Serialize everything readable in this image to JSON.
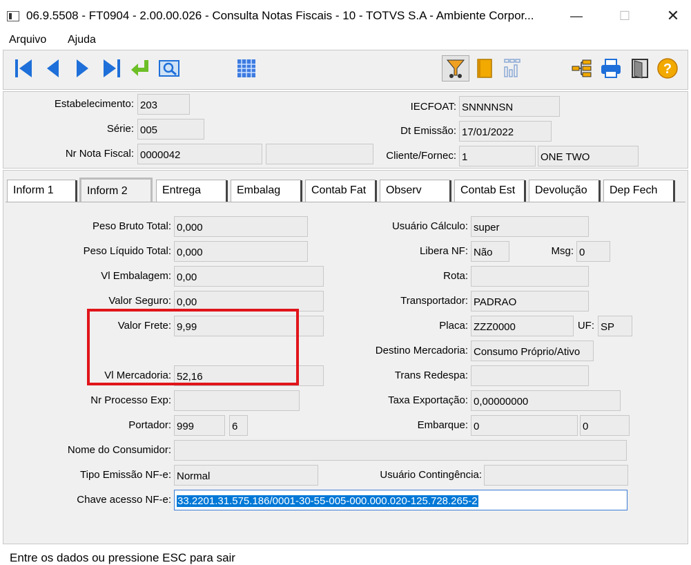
{
  "window": {
    "title": "06.9.5508 - FT0904 - 2.00.00.026 - Consulta Notas Fiscais - 10 - TOTVS S.A - Ambiente Corpor...",
    "minimize": "—",
    "maximize": "☐",
    "close": "✕"
  },
  "menu": {
    "file": "Arquivo",
    "help": "Ajuda"
  },
  "header": {
    "estabelecimento_label": "Estabelecimento:",
    "estabelecimento": "203",
    "serie_label": "Série:",
    "serie": "005",
    "nr_nota_label": "Nr Nota Fiscal:",
    "nr_nota": "0000042",
    "nr_nota_extra": "",
    "iecfoat_label": "IECFOAT:",
    "iecfoat": "SNNNNSN",
    "dt_emissao_label": "Dt Emissão:",
    "dt_emissao": "17/01/2022",
    "cliente_label": "Cliente/Fornec:",
    "cliente_code": "1",
    "cliente_name": "ONE TWO"
  },
  "tabs": [
    {
      "label": "Inform 1"
    },
    {
      "label": "Inform 2"
    },
    {
      "label": "Entrega"
    },
    {
      "label": "Embalag"
    },
    {
      "label": "Contab Fat"
    },
    {
      "label": "Observ"
    },
    {
      "label": "Contab Est"
    },
    {
      "label": "Devolução"
    },
    {
      "label": "Dep Fech"
    }
  ],
  "form": {
    "peso_bruto_label": "Peso Bruto Total:",
    "peso_bruto": "0,000",
    "peso_liquido_label": "Peso Líquido Total:",
    "peso_liquido": "0,000",
    "vl_embalagem_label": "Vl Embalagem:",
    "vl_embalagem": "0,00",
    "valor_seguro_label": "Valor Seguro:",
    "valor_seguro": "0,00",
    "valor_frete_label": "Valor Frete:",
    "valor_frete": "9,99",
    "vl_mercadoria_label": "Vl Mercadoria:",
    "vl_mercadoria": "52,16",
    "nr_processo_label": "Nr Processo Exp:",
    "nr_processo": "",
    "portador_label": "Portador:",
    "portador": "999",
    "portador_mod": "6",
    "nome_consumidor_label": "Nome do Consumidor:",
    "nome_consumidor": "",
    "tipo_emissao_label": "Tipo Emissão NF-e:",
    "tipo_emissao": "Normal",
    "chave_label": "Chave acesso NF-e:",
    "chave": "33.2201.31.575.186/0001-30-55-005-000.000.020-125.728.265-2",
    "usuario_calculo_label": "Usuário Cálculo:",
    "usuario_calculo": "super",
    "libera_nf_label": "Libera NF:",
    "libera_nf": "Não",
    "msg_label": "Msg:",
    "msg": "0",
    "rota_label": "Rota:",
    "rota": "",
    "transportador_label": "Transportador:",
    "transportador": "PADRAO",
    "placa_label": "Placa:",
    "placa": "ZZZ0000",
    "uf_label": "UF:",
    "uf": "SP",
    "destino_label": "Destino Mercadoria:",
    "destino": "Consumo Próprio/Ativo",
    "trans_redespa_label": "Trans Redespa:",
    "trans_redespa": "",
    "taxa_exportacao_label": "Taxa Exportação:",
    "taxa_exportacao": "0,00000000",
    "embarque_label": "Embarque:",
    "embarque": "0",
    "embarque2": "0",
    "usuario_contingencia_label": "Usuário Contingência:",
    "usuario_contingencia": ""
  },
  "status": {
    "text": "Entre os dados ou pressione ESC para sair"
  },
  "colors": {
    "highlight": "#e0151b",
    "nav_blue": "#1e6fd9",
    "selection": "#0078d7"
  }
}
